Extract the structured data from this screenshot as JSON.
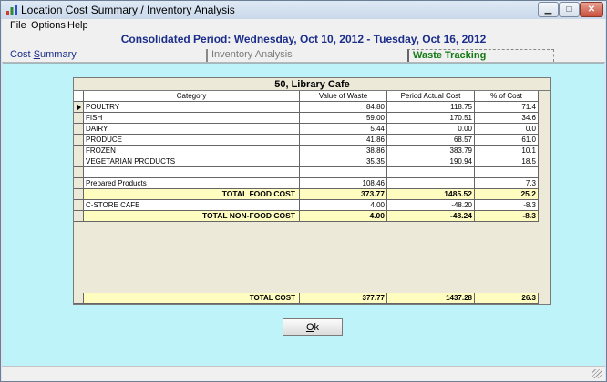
{
  "window": {
    "title": "Location Cost Summary / Inventory Analysis",
    "min_glyph": "▁",
    "max_glyph": "□",
    "close_glyph": "✕"
  },
  "menu": {
    "file": "File",
    "options": "Options",
    "help": "Help"
  },
  "header": {
    "period": "Consolidated Period: Wednesday, Oct 10, 2012 - Tuesday, Oct 16, 2012"
  },
  "tabs": {
    "cost_summary_prefix": "Cost ",
    "cost_summary_accel": "S",
    "cost_summary_suffix": "ummary",
    "inventory_analysis": "Inventory Analysis",
    "waste_tracking": "Waste Tracking"
  },
  "table": {
    "title": "50, Library Cafe",
    "headers": {
      "category": "Category",
      "value_of_waste": "Value of Waste",
      "period_actual_cost": "Period Actual Cost",
      "pct_of_cost": "% of Cost"
    },
    "rows": [
      {
        "category": "POULTRY",
        "waste": "84.80",
        "actual": "118.75",
        "pct": "71.4"
      },
      {
        "category": "FISH",
        "waste": "59.00",
        "actual": "170.51",
        "pct": "34.6"
      },
      {
        "category": "DAIRY",
        "waste": "5.44",
        "actual": "0.00",
        "pct": "0.0"
      },
      {
        "category": "PRODUCE",
        "waste": "41.86",
        "actual": "68.57",
        "pct": "61.0"
      },
      {
        "category": "FROZEN",
        "waste": "38.86",
        "actual": "383.79",
        "pct": "10.1"
      },
      {
        "category": "VEGETARIAN PRODUCTS",
        "waste": "35.35",
        "actual": "190.94",
        "pct": "18.5"
      },
      {
        "category": "",
        "waste": "",
        "actual": "",
        "pct": ""
      },
      {
        "category": "Prepared Products",
        "waste": "108.46",
        "actual": "",
        "pct": "7.3"
      },
      {
        "category": "TOTAL FOOD COST",
        "waste": "373.77",
        "actual": "1485.52",
        "pct": "25.2"
      },
      {
        "category": "C-STORE CAFE",
        "waste": "4.00",
        "actual": "-48.20",
        "pct": "-8.3"
      },
      {
        "category": "TOTAL NON-FOOD COST",
        "waste": "4.00",
        "actual": "-48.24",
        "pct": "-8.3"
      }
    ],
    "grand_total": {
      "category": "TOTAL COST",
      "waste": "377.77",
      "actual": "1437.28",
      "pct": "26.3"
    }
  },
  "ok_button": {
    "accel": "O",
    "rest": "k"
  }
}
